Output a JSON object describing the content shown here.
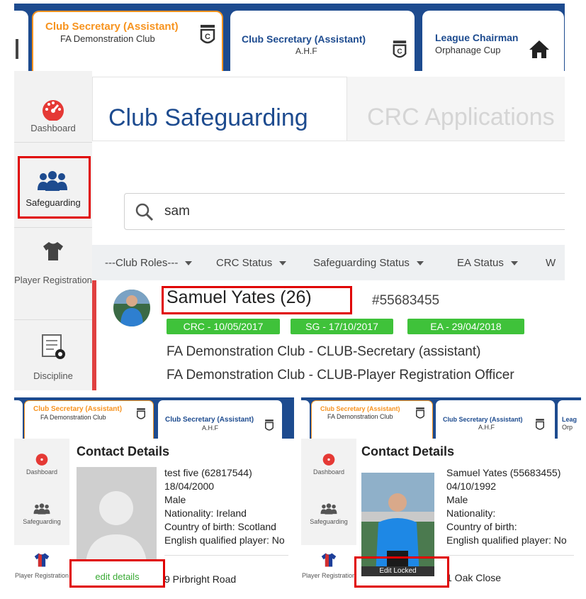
{
  "top": {
    "tabs": [
      {
        "title": "Club Secretary (Assistant)",
        "subtitle": "FA Demonstration Club",
        "active": true
      },
      {
        "title": "Club Secretary (Assistant)",
        "subtitle": "A.H.F",
        "active": false
      },
      {
        "title": "League Chairman",
        "subtitle": "Orphanage Cup",
        "active": false
      }
    ],
    "sidebar": [
      {
        "label": "Dashboard",
        "icon": "dashboard-icon"
      },
      {
        "label": "Safeguarding",
        "icon": "people-icon"
      },
      {
        "label": "Player Registration",
        "icon": "shirt-icon"
      },
      {
        "label": "Discipline",
        "icon": "discipline-icon"
      }
    ],
    "content_tabs": [
      "Club Safeguarding",
      "CRC Applications"
    ],
    "search_value": "sam",
    "filters": [
      "---Club Roles---",
      "CRC Status",
      "Safeguarding Status",
      "EA Status",
      "W"
    ],
    "result": {
      "name": "Samuel Yates (26)",
      "id": "#55683455",
      "badges": [
        "CRC - 10/05/2017",
        "SG - 17/10/2017",
        "EA - 29/04/2018"
      ],
      "roles": [
        "FA Demonstration Club - CLUB-Secretary (assistant)",
        "FA Demonstration Club - CLUB-Player Registration Officer"
      ]
    }
  },
  "panels": [
    {
      "tabs": [
        {
          "title": "Club Secretary (Assistant)",
          "subtitle": "FA Demonstration Club"
        },
        {
          "title": "Club Secretary (Assistant)",
          "subtitle": "A.H.F"
        }
      ],
      "sidebar": [
        "Dashboard",
        "Safeguarding",
        "Player Registration"
      ],
      "heading": "Contact Details",
      "lines": [
        "test five (62817544)",
        "18/04/2000",
        "Male",
        "Nationality: Ireland",
        "Country of birth: Scotland",
        "English qualified player: No"
      ],
      "address": "9 Pirbright Road",
      "button": "edit details"
    },
    {
      "tabs": [
        {
          "title": "Club Secretary (Assistant)",
          "subtitle": "FA Demonstration Club"
        },
        {
          "title": "Club Secretary (Assistant)",
          "subtitle": "A.H.F"
        },
        {
          "title": "Leag",
          "subtitle": "Orp"
        }
      ],
      "sidebar": [
        "Dashboard",
        "Safeguarding",
        "Player Registration"
      ],
      "heading": "Contact Details",
      "lines": [
        "Samuel Yates (55683455)",
        "04/10/1992",
        "Male",
        "Nationality:",
        "Country of birth:",
        "English qualified player: No"
      ],
      "address": "1 Oak Close",
      "button": "Edit Locked"
    }
  ],
  "colors": {
    "brand_blue": "#1d4b8f",
    "active_orange": "#f7931e",
    "highlight_red": "#e00000",
    "badge_green": "#3fc23a",
    "link_green": "#3aaa35"
  }
}
